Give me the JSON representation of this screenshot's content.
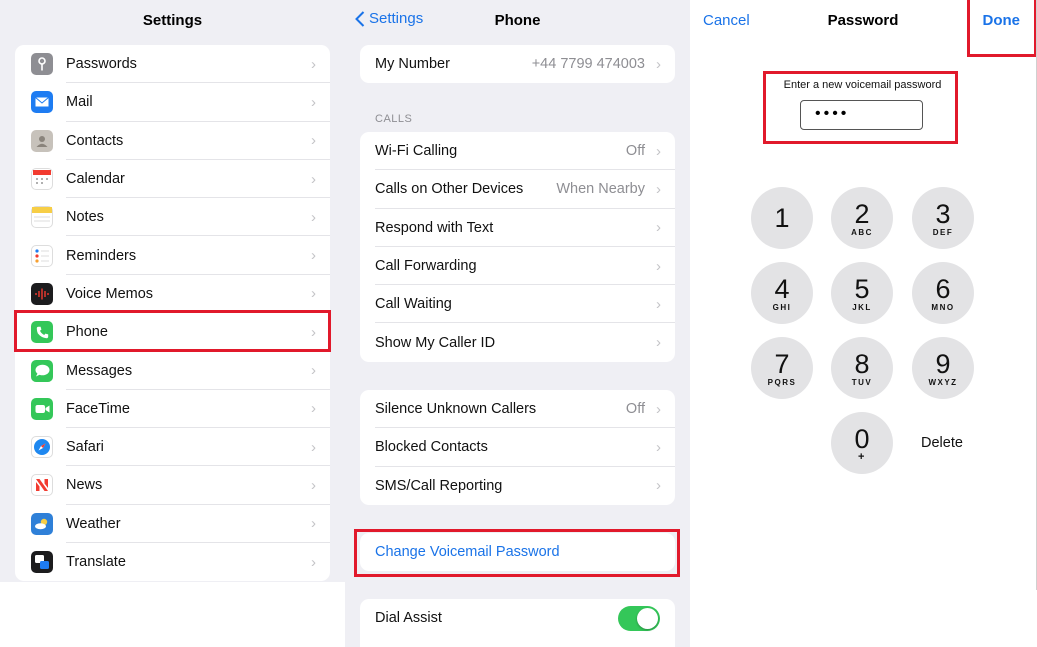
{
  "settings": {
    "title": "Settings",
    "items": [
      {
        "label": "Passwords",
        "icon": "key-icon",
        "color": "#8e8e93"
      },
      {
        "label": "Mail",
        "icon": "mail-icon",
        "color": "#1e7cf2"
      },
      {
        "label": "Contacts",
        "icon": "contacts-icon",
        "color": "#a8a29a"
      },
      {
        "label": "Calendar",
        "icon": "calendar-icon",
        "color": "#ffffff"
      },
      {
        "label": "Notes",
        "icon": "notes-icon",
        "color": "#ffffff"
      },
      {
        "label": "Reminders",
        "icon": "reminders-icon",
        "color": "#ffffff"
      },
      {
        "label": "Voice Memos",
        "icon": "voice-memos-icon",
        "color": "#1c1c1e"
      },
      {
        "label": "Phone",
        "icon": "phone-icon",
        "color": "#34c759"
      },
      {
        "label": "Messages",
        "icon": "messages-icon",
        "color": "#34c759"
      },
      {
        "label": "FaceTime",
        "icon": "facetime-icon",
        "color": "#34c759"
      },
      {
        "label": "Safari",
        "icon": "safari-icon",
        "color": "#1e88f0"
      },
      {
        "label": "News",
        "icon": "news-icon",
        "color": "#ffffff"
      },
      {
        "label": "Weather",
        "icon": "weather-icon",
        "color": "#2f80d8"
      },
      {
        "label": "Translate",
        "icon": "translate-icon",
        "color": "#1c1c1e"
      }
    ]
  },
  "phone": {
    "back_label": "Settings",
    "title": "Phone",
    "my_number": {
      "label": "My Number",
      "value": "+44 7799 474003"
    },
    "calls_header": "CALLS",
    "calls": [
      {
        "label": "Wi-Fi Calling",
        "value": "Off"
      },
      {
        "label": "Calls on Other Devices",
        "value": "When Nearby"
      },
      {
        "label": "Respond with Text",
        "value": ""
      },
      {
        "label": "Call Forwarding",
        "value": ""
      },
      {
        "label": "Call Waiting",
        "value": ""
      },
      {
        "label": "Show My Caller ID",
        "value": ""
      }
    ],
    "misc": [
      {
        "label": "Silence Unknown Callers",
        "value": "Off"
      },
      {
        "label": "Blocked Contacts",
        "value": ""
      },
      {
        "label": "SMS/Call Reporting",
        "value": ""
      }
    ],
    "change_voicemail": "Change Voicemail Password",
    "dial_assist": {
      "label": "Dial Assist",
      "on": true
    }
  },
  "password": {
    "cancel": "Cancel",
    "title": "Password",
    "done": "Done",
    "prompt": "Enter a new voicemail password",
    "field_value": "••••",
    "keys": [
      {
        "digit": "1",
        "letters": ""
      },
      {
        "digit": "2",
        "letters": "ABC"
      },
      {
        "digit": "3",
        "letters": "DEF"
      },
      {
        "digit": "4",
        "letters": "GHI"
      },
      {
        "digit": "5",
        "letters": "JKL"
      },
      {
        "digit": "6",
        "letters": "MNO"
      },
      {
        "digit": "7",
        "letters": "PQRS"
      },
      {
        "digit": "8",
        "letters": "TUV"
      },
      {
        "digit": "9",
        "letters": "WXYZ"
      },
      {
        "digit": "0",
        "letters": "+"
      }
    ],
    "delete_label": "Delete"
  }
}
